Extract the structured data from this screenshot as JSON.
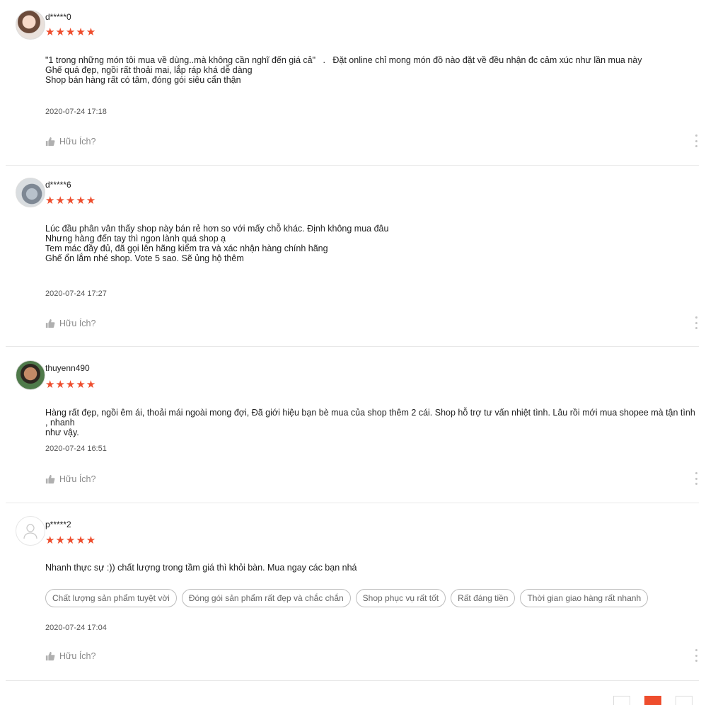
{
  "reviews": [
    {
      "username": "d*****0",
      "stars": "★★★★★",
      "lines": [
        "\"1 trong những món tôi mua về dùng..mà không cần nghĩ đến giá cả\"   .   Đặt online chỉ mong món đồ nào đặt về đều nhận đc cảm xúc như lần mua này",
        "Ghế quá đẹp, ngồi rất thoải mai, lắp ráp khá dễ dàng",
        "Shop bán hàng rất có tâm, đóng gói siêu cẩn thận"
      ],
      "date": "2020-07-24 17:18",
      "helpful": "Hữu Ích?"
    },
    {
      "username": "d*****6",
      "stars": "★★★★★",
      "lines": [
        "Lúc đầu phân vân thấy shop này bán rẻ hơn so với mấy chỗ khác. Định không mua đâu",
        "Nhưng hàng đến tay thì ngon lành quá shop ạ",
        "Tem mác đầy đủ, đã gọi lên hãng kiểm tra và xác nhận hàng chính hãng",
        "Ghế ổn lắm nhé shop. Vote 5 sao. Sẽ ủng hộ thêm"
      ],
      "date": "2020-07-24 17:27",
      "helpful": "Hữu Ích?"
    },
    {
      "username": "thuyenn490",
      "stars": "★★★★★",
      "lines": [
        "Hàng rất đẹp, ngồi êm ái, thoải mái ngoài mong đợi, Đã giới hiệu bạn bè mua của shop thêm 2 cái. Shop hỗ trợ tư vấn nhiệt tình. Lâu rồi mới mua shopee mà tận tình , nhanh",
        "như vậy."
      ],
      "date": "2020-07-24 16:51",
      "helpful": "Hữu Ích?"
    },
    {
      "username": "p*****2",
      "stars": "★★★★★",
      "lines": [
        "Nhanh thực sự :)) chất lượng trong tầm giá thì khỏi bàn. Mua ngay các bạn nhá"
      ],
      "tags": [
        "Chất lượng sản phẩm tuyệt vời",
        "Đóng gói sản phẩm rất đẹp và chắc chắn",
        "Shop phục vụ rất tốt",
        "Rất đáng tiền",
        "Thời gian giao hàng rất nhanh"
      ],
      "date": "2020-07-24 17:04",
      "helpful": "Hữu Ích?"
    }
  ],
  "colors": {
    "accent": "#ee4d2d",
    "muted": "#8a8a8a"
  },
  "icons": {
    "helpful": "thumbs-up-icon",
    "more": "more-vertical-icon",
    "avatar_placeholder": "user-icon"
  }
}
